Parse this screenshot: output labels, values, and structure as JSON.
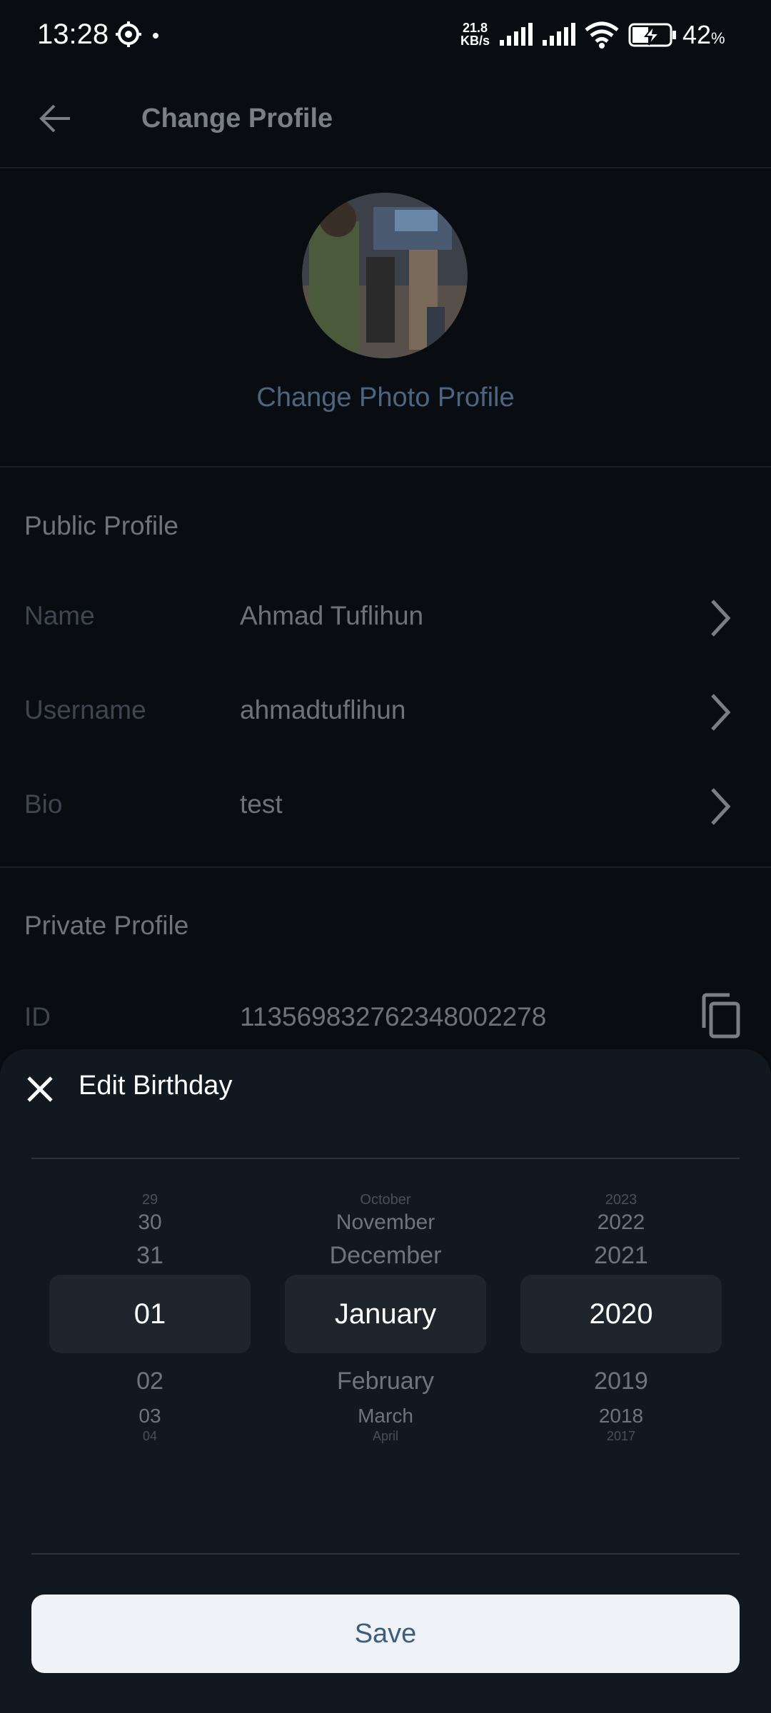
{
  "status_bar": {
    "time": "13:28",
    "net_speed_value": "21.8",
    "net_speed_unit": "KB/s",
    "battery_pct": "42",
    "battery_unit": "%"
  },
  "header": {
    "title": "Change Profile"
  },
  "profile_photo": {
    "change_label": "Change Photo Profile"
  },
  "public_profile": {
    "title": "Public Profile",
    "rows": [
      {
        "label": "Name",
        "value": "Ahmad Tuflihun"
      },
      {
        "label": "Username",
        "value": "ahmadtuflihun"
      },
      {
        "label": "Bio",
        "value": "test"
      }
    ]
  },
  "private_profile": {
    "title": "Private Profile",
    "id_label": "ID",
    "id_value": "1135698327623480022​78"
  },
  "sheet": {
    "title": "Edit Birthday",
    "day": {
      "items": [
        "29",
        "30",
        "31",
        "02",
        "03",
        "04"
      ],
      "selected": "01"
    },
    "month": {
      "items": [
        "October",
        "November",
        "December",
        "February",
        "March",
        "April"
      ],
      "selected": "January"
    },
    "year": {
      "items": [
        "2023",
        "2022",
        "2021",
        "2019",
        "2018",
        "2017"
      ],
      "selected": "2020"
    },
    "save_label": "Save"
  },
  "colors": {
    "background": "#090c10",
    "sheet": "#121820",
    "accent": "#4c6580",
    "save_button": "#eff2f7"
  }
}
